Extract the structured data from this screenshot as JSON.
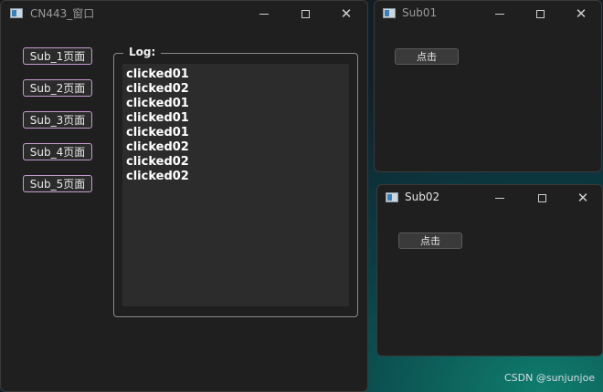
{
  "main_window": {
    "title": "CN443_窗口",
    "buttons": [
      "Sub_1页面",
      "Sub_2页面",
      "Sub_3页面",
      "Sub_4页面",
      "Sub_5页面"
    ],
    "log_title": "Log:",
    "log_lines": [
      "clicked01",
      "clicked02",
      "clicked01",
      "clicked01",
      "clicked01",
      "clicked02",
      "clicked02",
      "clicked02"
    ]
  },
  "sub01_window": {
    "title": "Sub01",
    "button_label": "点击"
  },
  "sub02_window": {
    "title": "Sub02",
    "button_label": "点击"
  },
  "watermark": "CSDN @sunjunjoe",
  "icons": {
    "window_icon": "app-window-icon",
    "minimize": "minimize-icon",
    "maximize": "maximize-icon",
    "close": "close-icon"
  },
  "colors": {
    "window_bg": "#1f1f1f",
    "button_border": "#c79ad1",
    "log_bg": "#2c2c2c"
  }
}
